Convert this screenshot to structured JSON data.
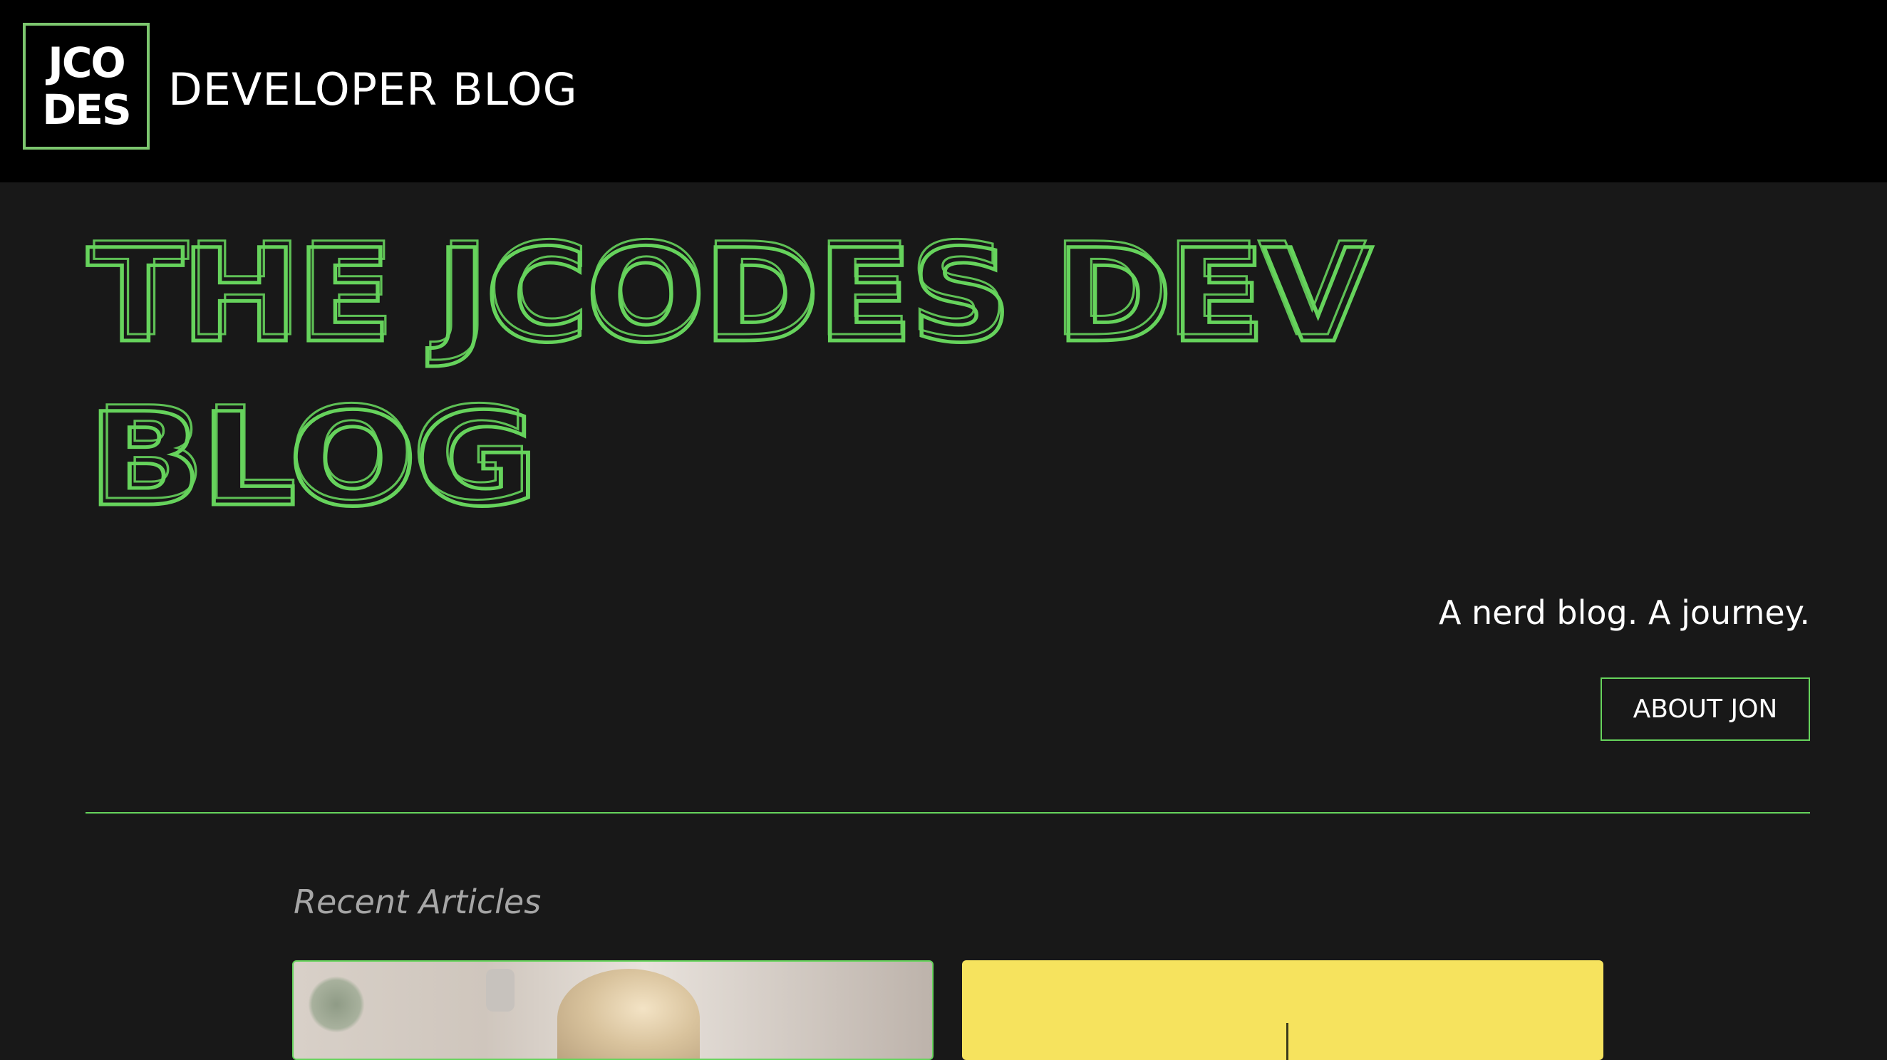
{
  "header": {
    "logo_line1": "JCO",
    "logo_line2": "DES",
    "site_title": "DEVELOPER BLOG"
  },
  "hero": {
    "title_line1": "THE JCODES DEV",
    "title_line2": "BLOG",
    "tagline": "A nerd blog. A journey.",
    "about_button": "ABOUT JON"
  },
  "recent": {
    "section_title": "Recent Articles"
  },
  "colors": {
    "accent": "#66d35c",
    "background": "#181818",
    "header_bg": "#000000"
  }
}
